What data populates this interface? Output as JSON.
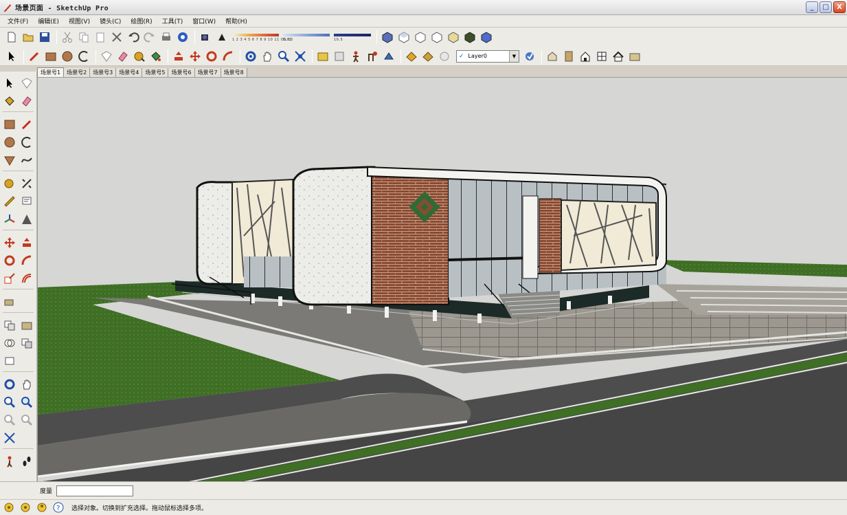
{
  "window": {
    "title": "场景页面 - SketchUp Pro",
    "minimize_label": "_",
    "maximize_label": "□",
    "close_label": "X"
  },
  "menu": [
    "文件(F)",
    "编辑(E)",
    "视图(V)",
    "镜头(C)",
    "绘图(R)",
    "工具(T)",
    "窗口(W)",
    "帮助(H)"
  ],
  "toolbar": {
    "layer_selected": "Layer0",
    "layer_checked": "✓",
    "scale_labels": [
      "1 2 3 4 5 6 7 8 9 10 11 OS.50",
      "0.01",
      "10.5"
    ]
  },
  "scene_tabs": [
    "场景号1",
    "场景号2",
    "场景号3",
    "场景号4",
    "场景号5",
    "场景号6",
    "场景号7",
    "场景号8"
  ],
  "active_scene_index": 0,
  "measurement": {
    "label": "度量",
    "value": ""
  },
  "status": {
    "message": "选择对象。切换到扩充选择。拖动鼠标选择多项。"
  },
  "colors": {
    "sky": "#d6d6d4",
    "grass": "#3f6e25",
    "road": "#4d4d4d",
    "brick": "#8b4a33",
    "accent_blue": "#1f4fa8"
  }
}
